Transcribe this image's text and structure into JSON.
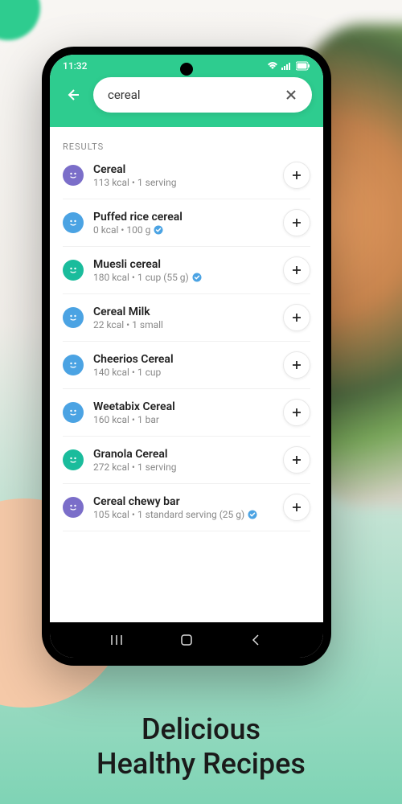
{
  "status": {
    "time": "11:32"
  },
  "search": {
    "query": "cereal"
  },
  "results": {
    "label": "RESULTS",
    "items": [
      {
        "name": "Cereal",
        "sub": "113 kcal • 1 serving",
        "icon": "purple",
        "verified": false
      },
      {
        "name": "Puffed rice cereal",
        "sub": "0 kcal • 100 g",
        "icon": "blue",
        "verified": true
      },
      {
        "name": "Muesli cereal",
        "sub": "180 kcal • 1 cup (55 g)",
        "icon": "teal",
        "verified": true
      },
      {
        "name": "Cereal Milk",
        "sub": "22 kcal • 1 small",
        "icon": "blue",
        "verified": false
      },
      {
        "name": "Cheerios Cereal",
        "sub": "140 kcal • 1 cup",
        "icon": "blue",
        "verified": false
      },
      {
        "name": "Weetabix Cereal",
        "sub": "160 kcal • 1 bar",
        "icon": "blue",
        "verified": false
      },
      {
        "name": "Granola Cereal",
        "sub": "272 kcal • 1 serving",
        "icon": "teal",
        "verified": false
      },
      {
        "name": "Cereal chewy bar",
        "sub": "105 kcal • 1 standard serving (25 g)",
        "icon": "purple",
        "verified": true
      }
    ]
  },
  "tagline": {
    "line1": "Delicious",
    "line2": "Healthy Recipes"
  }
}
